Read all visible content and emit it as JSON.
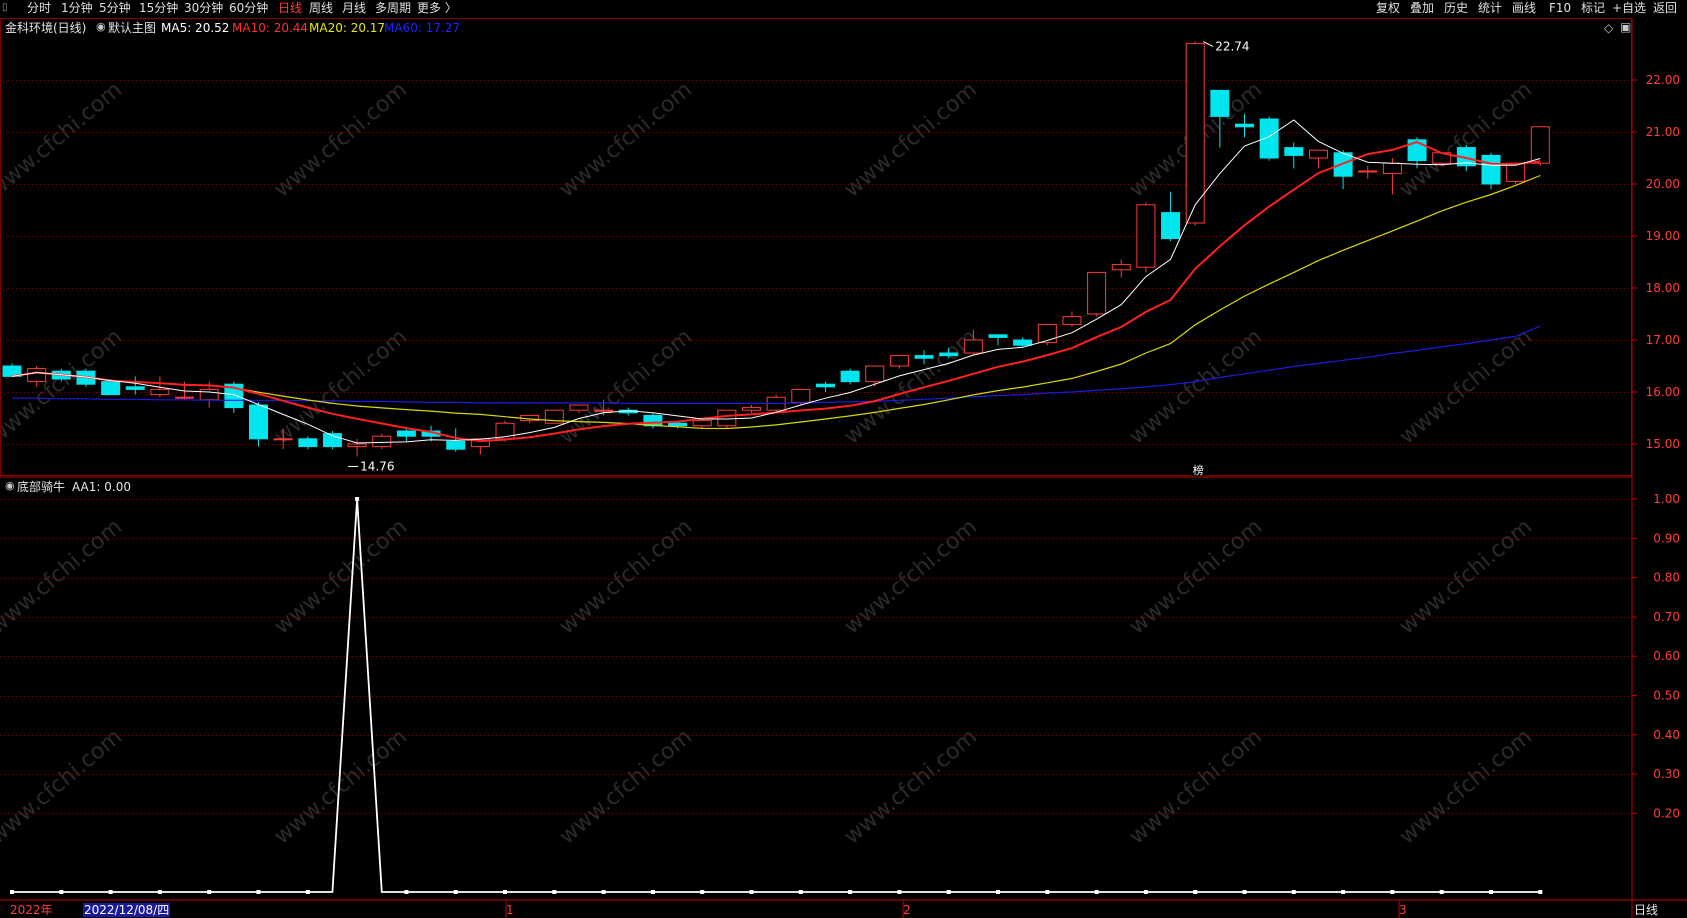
{
  "toolbar": {
    "left_items": [
      "分时",
      "1分钟",
      "5分钟",
      "15分钟",
      "30分钟",
      "60分钟",
      "日线",
      "周线",
      "月线",
      "多周期",
      "更多 〉"
    ],
    "active": "日线",
    "right_items": [
      "复权",
      "叠加",
      "历史",
      "统计",
      "画线",
      "F10",
      "标记",
      "+自选",
      "返回"
    ]
  },
  "main_panel": {
    "stock_name": "金科环境(日线)",
    "template": "默认主图",
    "indicators": [
      {
        "label": "MA5: 20.52",
        "color": "#ffffff"
      },
      {
        "label": "MA10: 20.44",
        "color": "#ff3030"
      },
      {
        "label": "MA20: 20.17",
        "color": "#e8e800"
      },
      {
        "label": "MA60: 17.27",
        "color": "#2020ff"
      }
    ],
    "y_ticks": [
      "22.00",
      "21.00",
      "20.00",
      "19.00",
      "18.00",
      "17.00",
      "16.00",
      "15.00"
    ],
    "high_label": "22.74",
    "low_label": "14.76",
    "event_marker": "榜"
  },
  "sub_panel": {
    "name": "底部骑牛",
    "value_label": "AA1: 0.00",
    "y_ticks": [
      "1.00",
      "0.90",
      "0.80",
      "0.70",
      "0.60",
      "0.50",
      "0.40",
      "0.30",
      "0.20"
    ]
  },
  "x_axis": {
    "year_label": "2022年",
    "cursor_date": "2022/12/08/四",
    "month_marks": [
      "1",
      "2",
      "3"
    ],
    "period": "日线"
  },
  "watermark": "www.cfchi.com",
  "colors": {
    "up": "#ff3b3b",
    "down": "#00e5ee",
    "ma5": "#ffffff",
    "ma10": "#ff2020",
    "ma20": "#d8d800",
    "ma60": "#1c1ce0",
    "grid": "#7a0000"
  },
  "chart_data": {
    "type": "candlestick",
    "candles": [
      {
        "o": 16.5,
        "h": 16.55,
        "c": 16.3,
        "l": 16.3
      },
      {
        "o": 16.2,
        "h": 16.5,
        "c": 16.45,
        "l": 16.1
      },
      {
        "o": 16.4,
        "h": 16.45,
        "c": 16.25,
        "l": 16.2
      },
      {
        "o": 16.4,
        "h": 16.45,
        "c": 16.15,
        "l": 16.1
      },
      {
        "o": 16.2,
        "h": 16.25,
        "c": 15.95,
        "l": 15.95
      },
      {
        "o": 16.1,
        "h": 16.3,
        "c": 16.05,
        "l": 15.95
      },
      {
        "o": 15.95,
        "h": 16.3,
        "c": 16.05,
        "l": 15.9
      },
      {
        "o": 15.9,
        "h": 16.2,
        "c": 15.9,
        "l": 15.85
      },
      {
        "o": 15.85,
        "h": 16.2,
        "c": 16.05,
        "l": 15.7
      },
      {
        "o": 16.15,
        "h": 16.2,
        "c": 15.7,
        "l": 15.6
      },
      {
        "o": 15.75,
        "h": 15.8,
        "c": 15.1,
        "l": 14.95
      },
      {
        "o": 15.1,
        "h": 15.3,
        "c": 15.1,
        "l": 14.9
      },
      {
        "o": 15.1,
        "h": 15.15,
        "c": 14.95,
        "l": 14.9
      },
      {
        "o": 15.2,
        "h": 15.25,
        "c": 14.95,
        "l": 14.9
      },
      {
        "o": 14.95,
        "h": 15.1,
        "c": 15.0,
        "l": 14.76
      },
      {
        "o": 14.95,
        "h": 15.2,
        "c": 15.15,
        "l": 14.9
      },
      {
        "o": 15.25,
        "h": 15.3,
        "c": 15.15,
        "l": 15.05
      },
      {
        "o": 15.25,
        "h": 15.35,
        "c": 15.15,
        "l": 15.05
      },
      {
        "o": 15.05,
        "h": 15.3,
        "c": 14.9,
        "l": 14.85
      },
      {
        "o": 14.95,
        "h": 15.1,
        "c": 15.1,
        "l": 14.8
      },
      {
        "o": 15.1,
        "h": 15.45,
        "c": 15.4,
        "l": 15.05
      },
      {
        "o": 15.45,
        "h": 15.55,
        "c": 15.55,
        "l": 15.4
      },
      {
        "o": 15.4,
        "h": 15.65,
        "c": 15.65,
        "l": 15.4
      },
      {
        "o": 15.65,
        "h": 15.75,
        "c": 15.75,
        "l": 15.6
      },
      {
        "o": 15.65,
        "h": 15.85,
        "c": 15.65,
        "l": 15.55
      },
      {
        "o": 15.65,
        "h": 15.7,
        "c": 15.6,
        "l": 15.55
      },
      {
        "o": 15.55,
        "h": 15.6,
        "c": 15.35,
        "l": 15.3
      },
      {
        "o": 15.4,
        "h": 15.45,
        "c": 15.35,
        "l": 15.3
      },
      {
        "o": 15.35,
        "h": 15.45,
        "c": 15.45,
        "l": 15.3
      },
      {
        "o": 15.35,
        "h": 15.65,
        "c": 15.65,
        "l": 15.3
      },
      {
        "o": 15.65,
        "h": 15.75,
        "c": 15.7,
        "l": 15.6
      },
      {
        "o": 15.65,
        "h": 15.95,
        "c": 15.9,
        "l": 15.6
      },
      {
        "o": 15.8,
        "h": 16.05,
        "c": 16.05,
        "l": 15.75
      },
      {
        "o": 16.15,
        "h": 16.2,
        "c": 16.1,
        "l": 16.0
      },
      {
        "o": 16.4,
        "h": 16.45,
        "c": 16.2,
        "l": 16.15
      },
      {
        "o": 16.2,
        "h": 16.5,
        "c": 16.5,
        "l": 16.1
      },
      {
        "o": 16.5,
        "h": 16.7,
        "c": 16.7,
        "l": 16.45
      },
      {
        "o": 16.7,
        "h": 16.8,
        "c": 16.65,
        "l": 16.55
      },
      {
        "o": 16.75,
        "h": 16.85,
        "c": 16.7,
        "l": 16.65
      },
      {
        "o": 16.75,
        "h": 17.2,
        "c": 17.0,
        "l": 16.7
      },
      {
        "o": 17.1,
        "h": 17.1,
        "c": 17.05,
        "l": 16.9
      },
      {
        "o": 17.0,
        "h": 17.05,
        "c": 16.9,
        "l": 16.85
      },
      {
        "o": 16.95,
        "h": 17.3,
        "c": 17.3,
        "l": 16.9
      },
      {
        "o": 17.3,
        "h": 17.55,
        "c": 17.45,
        "l": 17.25
      },
      {
        "o": 17.5,
        "h": 18.3,
        "c": 18.3,
        "l": 17.45
      },
      {
        "o": 18.35,
        "h": 18.55,
        "c": 18.45,
        "l": 18.2
      },
      {
        "o": 18.4,
        "h": 19.65,
        "c": 19.6,
        "l": 18.3
      },
      {
        "o": 19.45,
        "h": 19.85,
        "c": 18.95,
        "l": 18.9
      },
      {
        "o": 19.25,
        "h": 22.74,
        "c": 22.7,
        "l": 19.2
      },
      {
        "o": 21.8,
        "h": 21.8,
        "c": 21.3,
        "l": 20.7
      },
      {
        "o": 21.15,
        "h": 21.35,
        "c": 21.1,
        "l": 20.9
      },
      {
        "o": 21.25,
        "h": 21.3,
        "c": 20.5,
        "l": 20.45
      },
      {
        "o": 20.7,
        "h": 20.8,
        "c": 20.55,
        "l": 20.3
      },
      {
        "o": 20.5,
        "h": 20.55,
        "c": 20.65,
        "l": 20.3
      },
      {
        "o": 20.6,
        "h": 20.65,
        "c": 20.15,
        "l": 19.9
      },
      {
        "o": 20.25,
        "h": 20.35,
        "c": 20.25,
        "l": 20.1
      },
      {
        "o": 20.2,
        "h": 20.5,
        "c": 20.4,
        "l": 19.8
      },
      {
        "o": 20.85,
        "h": 20.9,
        "c": 20.45,
        "l": 20.3
      },
      {
        "o": 20.4,
        "h": 20.6,
        "c": 20.6,
        "l": 20.35
      },
      {
        "o": 20.7,
        "h": 20.75,
        "c": 20.35,
        "l": 20.25
      },
      {
        "o": 20.55,
        "h": 20.6,
        "c": 20.0,
        "l": 19.9
      },
      {
        "o": 20.05,
        "h": 20.4,
        "c": 20.4,
        "l": 20.0
      },
      {
        "o": 20.4,
        "h": 21.1,
        "c": 21.1,
        "l": 20.35
      }
    ],
    "ma60": [
      15.88,
      15.88,
      15.87,
      15.87,
      15.86,
      15.86,
      15.85,
      15.85,
      15.84,
      15.84,
      15.84,
      15.84,
      15.83,
      15.83,
      15.82,
      15.82,
      15.81,
      15.8,
      15.8,
      15.79,
      15.79,
      15.79,
      15.79,
      15.79,
      15.79,
      15.78,
      15.78,
      15.78,
      15.78,
      15.78,
      15.78,
      15.78,
      15.79,
      15.8,
      15.81,
      15.82,
      15.84,
      15.86,
      15.88,
      15.91,
      15.93,
      15.95,
      15.98,
      16.0,
      16.03,
      16.06,
      16.1,
      16.14,
      16.2,
      16.28,
      16.35,
      16.42,
      16.49,
      16.55,
      16.61,
      16.67,
      16.74,
      16.8,
      16.87,
      16.93,
      17.0,
      17.07,
      17.27
    ],
    "subchart": {
      "name": "底部骑牛",
      "series": "AA1",
      "spike_index": 14,
      "spike_value": 1.0,
      "baseline": 0.0
    }
  }
}
